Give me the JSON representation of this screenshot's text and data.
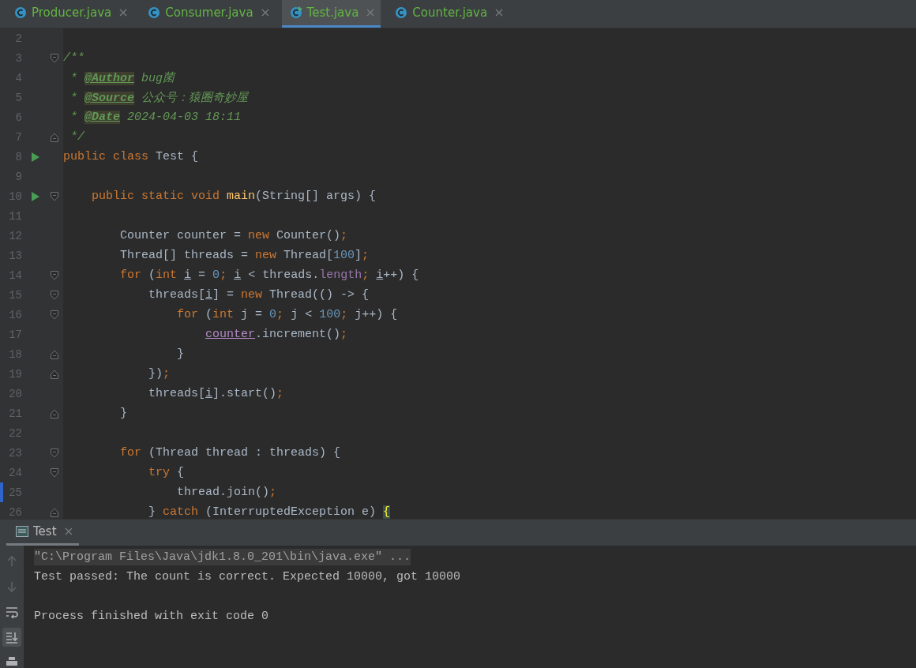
{
  "tabs": [
    {
      "label": "Producer.java",
      "selected": false,
      "runnable": false
    },
    {
      "label": "Consumer.java",
      "selected": false,
      "runnable": false
    },
    {
      "label": "Test.java",
      "selected": true,
      "runnable": true
    },
    {
      "label": "Counter.java",
      "selected": false,
      "runnable": false
    }
  ],
  "editor": {
    "lines": [
      {
        "number": "2",
        "run": false,
        "fold_open": false,
        "fold_close": false,
        "marked": false
      },
      {
        "number": "3",
        "run": false,
        "fold_open": true,
        "fold_close": false,
        "marked": false,
        "tokens": [
          {
            "text": "/**",
            "kind": "doc"
          }
        ]
      },
      {
        "number": "4",
        "run": false,
        "fold_open": false,
        "fold_close": false,
        "marked": false,
        "tokens": [
          {
            "text": " * ",
            "kind": "doc"
          },
          {
            "text": "@Author",
            "kind": "doctag"
          },
          {
            "text": " bug菌",
            "kind": "doc"
          }
        ]
      },
      {
        "number": "5",
        "run": false,
        "fold_open": false,
        "fold_close": false,
        "marked": false,
        "tokens": [
          {
            "text": " * ",
            "kind": "doc"
          },
          {
            "text": "@Source",
            "kind": "doctag"
          },
          {
            "text": " 公众号：猿圈奇妙屋",
            "kind": "doc"
          }
        ]
      },
      {
        "number": "6",
        "run": false,
        "fold_open": false,
        "fold_close": false,
        "marked": false,
        "tokens": [
          {
            "text": " * ",
            "kind": "doc"
          },
          {
            "text": "@Date",
            "kind": "doctag"
          },
          {
            "text": " 2024-04-03 18:11",
            "kind": "doc"
          }
        ]
      },
      {
        "number": "7",
        "run": false,
        "fold_open": false,
        "fold_close": true,
        "marked": false,
        "tokens": [
          {
            "text": " */",
            "kind": "doc"
          }
        ]
      },
      {
        "number": "8",
        "run": true,
        "fold_open": false,
        "fold_close": false,
        "marked": false,
        "tokens": [
          {
            "text": "public class ",
            "kind": "keyword"
          },
          {
            "text": "Test {",
            "kind": "plain"
          }
        ]
      },
      {
        "number": "9",
        "run": false,
        "fold_open": false,
        "fold_close": false,
        "marked": false
      },
      {
        "number": "10",
        "run": true,
        "fold_open": true,
        "fold_close": false,
        "marked": false,
        "tokens": [
          {
            "text": "    public static void ",
            "kind": "keyword"
          },
          {
            "text": "main",
            "kind": "method"
          },
          {
            "text": "(String[] args) {",
            "kind": "plain"
          }
        ]
      },
      {
        "number": "11",
        "run": false,
        "fold_open": false,
        "fold_close": false,
        "marked": false
      },
      {
        "number": "12",
        "run": false,
        "fold_open": false,
        "fold_close": false,
        "marked": false,
        "tokens": [
          {
            "text": "        Counter counter = ",
            "kind": "plain"
          },
          {
            "text": "new ",
            "kind": "keyword"
          },
          {
            "text": "Counter()",
            "kind": "plain"
          },
          {
            "text": ";",
            "kind": "keyword"
          }
        ]
      },
      {
        "number": "13",
        "run": false,
        "fold_open": false,
        "fold_close": false,
        "marked": false,
        "tokens": [
          {
            "text": "        Thread[] threads = ",
            "kind": "plain"
          },
          {
            "text": "new ",
            "kind": "keyword"
          },
          {
            "text": "Thread[",
            "kind": "plain"
          },
          {
            "text": "100",
            "kind": "number"
          },
          {
            "text": "]",
            "kind": "plain"
          },
          {
            "text": ";",
            "kind": "keyword"
          }
        ]
      },
      {
        "number": "14",
        "run": false,
        "fold_open": true,
        "fold_close": false,
        "marked": false,
        "tokens": [
          {
            "text": "        for ",
            "kind": "keyword"
          },
          {
            "text": "(",
            "kind": "plain"
          },
          {
            "text": "int ",
            "kind": "keyword"
          },
          {
            "text": "i",
            "kind": "var"
          },
          {
            "text": " = ",
            "kind": "plain"
          },
          {
            "text": "0",
            "kind": "number"
          },
          {
            "text": "; ",
            "kind": "keyword"
          },
          {
            "text": "i",
            "kind": "var"
          },
          {
            "text": " < threads.",
            "kind": "plain"
          },
          {
            "text": "length",
            "kind": "field"
          },
          {
            "text": "; ",
            "kind": "keyword"
          },
          {
            "text": "i",
            "kind": "var"
          },
          {
            "text": "++) {",
            "kind": "plain"
          }
        ]
      },
      {
        "number": "15",
        "run": false,
        "fold_open": true,
        "fold_close": false,
        "marked": false,
        "tokens": [
          {
            "text": "            threads[",
            "kind": "plain"
          },
          {
            "text": "i",
            "kind": "var"
          },
          {
            "text": "] = ",
            "kind": "plain"
          },
          {
            "text": "new ",
            "kind": "keyword"
          },
          {
            "text": "Thread(() -> {",
            "kind": "plain"
          }
        ]
      },
      {
        "number": "16",
        "run": false,
        "fold_open": true,
        "fold_close": false,
        "marked": false,
        "tokens": [
          {
            "text": "                for ",
            "kind": "keyword"
          },
          {
            "text": "(",
            "kind": "plain"
          },
          {
            "text": "int ",
            "kind": "keyword"
          },
          {
            "text": "j = ",
            "kind": "plain"
          },
          {
            "text": "0",
            "kind": "number"
          },
          {
            "text": "; ",
            "kind": "keyword"
          },
          {
            "text": "j < ",
            "kind": "plain"
          },
          {
            "text": "100",
            "kind": "number"
          },
          {
            "text": "; ",
            "kind": "keyword"
          },
          {
            "text": "j++) {",
            "kind": "plain"
          }
        ]
      },
      {
        "number": "17",
        "run": false,
        "fold_open": false,
        "fold_close": false,
        "marked": false,
        "tokens": [
          {
            "text": "                    counter",
            "kind": "captured"
          },
          {
            "text": ".increment()",
            "kind": "plain"
          },
          {
            "text": ";",
            "kind": "keyword"
          }
        ]
      },
      {
        "number": "18",
        "run": false,
        "fold_open": false,
        "fold_close": true,
        "marked": false,
        "tokens": [
          {
            "text": "                }",
            "kind": "plain"
          }
        ]
      },
      {
        "number": "19",
        "run": false,
        "fold_open": false,
        "fold_close": true,
        "marked": false,
        "tokens": [
          {
            "text": "            })",
            "kind": "plain"
          },
          {
            "text": ";",
            "kind": "keyword"
          }
        ]
      },
      {
        "number": "20",
        "run": false,
        "fold_open": false,
        "fold_close": false,
        "marked": false,
        "tokens": [
          {
            "text": "            threads[",
            "kind": "plain"
          },
          {
            "text": "i",
            "kind": "var"
          },
          {
            "text": "].start()",
            "kind": "plain"
          },
          {
            "text": ";",
            "kind": "keyword"
          }
        ]
      },
      {
        "number": "21",
        "run": false,
        "fold_open": false,
        "fold_close": true,
        "marked": false,
        "tokens": [
          {
            "text": "        }",
            "kind": "plain"
          }
        ]
      },
      {
        "number": "22",
        "run": false,
        "fold_open": false,
        "fold_close": false,
        "marked": false
      },
      {
        "number": "23",
        "run": false,
        "fold_open": true,
        "fold_close": false,
        "marked": false,
        "tokens": [
          {
            "text": "        for ",
            "kind": "keyword"
          },
          {
            "text": "(Thread thread : threads) {",
            "kind": "plain"
          }
        ]
      },
      {
        "number": "24",
        "run": false,
        "fold_open": true,
        "fold_close": false,
        "marked": false,
        "tokens": [
          {
            "text": "            try ",
            "kind": "keyword"
          },
          {
            "text": "{",
            "kind": "plain"
          }
        ]
      },
      {
        "number": "25",
        "run": false,
        "fold_open": false,
        "fold_close": false,
        "marked": true,
        "tokens": [
          {
            "text": "                thread.join()",
            "kind": "plain"
          },
          {
            "text": ";",
            "kind": "keyword"
          }
        ]
      },
      {
        "number": "26",
        "run": false,
        "fold_open": false,
        "fold_close": true,
        "marked": false,
        "tokens": [
          {
            "text": "            } ",
            "kind": "plain"
          },
          {
            "text": "catch ",
            "kind": "keyword"
          },
          {
            "text": "(InterruptedException e) ",
            "kind": "plain"
          },
          {
            "text": "{",
            "kind": "match"
          }
        ]
      }
    ]
  },
  "console": {
    "tab": {
      "label": "Test"
    },
    "toolbar": [
      {
        "kind": "up",
        "selected": false
      },
      {
        "kind": "down",
        "selected": false
      },
      {
        "kind": "wrap",
        "selected": false
      },
      {
        "kind": "scroll-end",
        "selected": true
      },
      {
        "kind": "print",
        "selected": false
      }
    ],
    "lines": [
      {
        "text": "\"C:\\Program Files\\Java\\jdk1.8.0_201\\bin\\java.exe\" ...",
        "kind": "command"
      },
      {
        "text": "Test passed: The count is correct. Expected 10000, got 10000",
        "kind": "output"
      },
      {
        "kind": "blank"
      },
      {
        "text": "Process finished with exit code 0",
        "kind": "output"
      }
    ]
  }
}
